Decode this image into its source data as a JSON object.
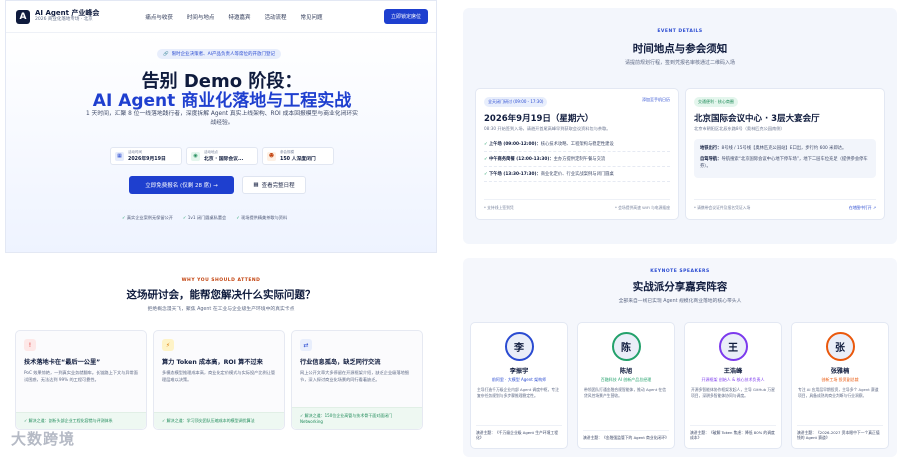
{
  "nav": {
    "logo_letter": "A",
    "brand_title": "AI Agent 产业峰会",
    "brand_sub": "2026 商业化落地专场 · 北京",
    "links": [
      "痛点与收获",
      "时间与地点",
      "特邀嘉宾",
      "活动流程",
      "常见问题"
    ],
    "cta": "立即锁定席位"
  },
  "hero": {
    "pill": "限时企业决策者、AI产品负责人等席位的开放门登记",
    "title_line1": "告别 Demo 阶段：",
    "title_line2": "AI Agent 商业化落地与工程实战",
    "subtitle": "1 天时间，汇聚 8 位一线落地践行者，深度拆解 Agent 真实上线架构、ROI 成本回报模型与商业化闭环实战经验。",
    "info": [
      {
        "icon": "calendar-icon",
        "label": "活动时间",
        "value": "2026年9月19日"
      },
      {
        "icon": "location-icon",
        "label": "活动地点",
        "value": "北京 · 国际会议..."
      },
      {
        "icon": "people-icon",
        "label": "参会规模",
        "value": "150 人深度闭门"
      }
    ],
    "cta_primary": "立即免费报名 (仅剩 28 席) →",
    "cta_secondary": "查看完整日程",
    "badges": [
      "真实企业案例无保留公开",
      "1v1 闭门圆桌私董会",
      "现场提供精美茶歇与资料"
    ]
  },
  "event": {
    "kicker": "EVENT DETAILS",
    "title": "时间地点与参会须知",
    "subtitle": "请提前规划行程，签到凭报名审核通过二维码入场",
    "time_card": {
      "tag": "全天闭门研讨 (09:00 - 17:30)",
      "link": "添加至手机日历",
      "date": "2026年9月19日（星期六）",
      "note": "08:30 开始签到入场，请避开首尾高峰早到获取会议资料包与茶歇。",
      "rows": [
        {
          "time": "上午场 (09:00-12:00)：",
          "text": "核心技术攻略、工程架构与稳定性建设"
        },
        {
          "time": "中午商务简餐 (12:00-13:30)：",
          "text": "主办方提供定制午餐与交流"
        },
        {
          "time": "下午场 (13:30-17:30)：",
          "text": "商业化定价、行业实战案例与闭门圆桌"
        }
      ],
      "foot_left": "* 支持线上签到凭",
      "foot_right": "* 会场提供高速 WiFi 与电源插座"
    },
    "loc_card": {
      "tag": "交通便利 · 核心商圈",
      "venue": "北京国际会议中心 · 3层大宴会厅",
      "address": "北京市朝阳区北辰东路8号（奥林匹克公园南侧）",
      "rows": [
        {
          "label": "地铁出行：",
          "text": "8号线 / 15号线【奥林匹克公园站】E口出，步行约 600 米即达。"
        },
        {
          "label": "自驾导航：",
          "text": "导航搜索“北京国际会议中心地下停车场”，地下二层车位充足（提供参会停车券）。"
        }
      ],
      "foot_left": "* 请携带会议证件及报名凭证入场",
      "foot_right": "在地图中打开 ↗"
    }
  },
  "why": {
    "kicker": "WHY YOU SHOULD ATTEND",
    "title": "这场研讨会，能帮您解决什么实际问题？",
    "subtitle": "拒绝概念漫天飞，聚焦 Agent 在工业与企业级生产环境中的真实卡点",
    "cards": [
      {
        "icon": "alert-icon",
        "glyph": "!",
        "title": "技术落地卡在“最后一公里”",
        "desc": "PoC 效果惊艳，一到真实业务就翻车。长链路上下文与异常面试困惑，无法达到 99% 的工程可靠性。",
        "solution": "✓ 解决之道：剖析头部企业工程化容错与评测体系"
      },
      {
        "icon": "lightning-icon",
        "glyph": "⚡",
        "title": "算力 Token 成本高，ROI 算不过来",
        "desc": "多模态模型推理成本高，商业化定价模式与实际投产比例让管理层难以决策。",
        "solution": "✓ 解决之道：学习顶尖团队压缩成本的模型调优算法"
      },
      {
        "icon": "shuffle-icon",
        "glyph": "⇄",
        "title": "行业信息孤岛，缺乏同行交流",
        "desc": "网上公开文章大多停留在开源框架介绍，缺乏企业级落地细节，深入探讨商业化场景的同行看着缺乏。",
        "solution": "✓ 解决之道：150位企业高管与技术骨干面对面闭门 Networking"
      }
    ],
    "watermark": "大数跨境"
  },
  "speakers": {
    "kicker": "KEYNOTE SPEAKERS",
    "title": "实战派分享嘉宾阵容",
    "subtitle": "全部来自一线已实现 Agent 规模化商业落地的核心带头人",
    "list": [
      {
        "initial": "李",
        "name": "李振宇",
        "role": "前阿里 · 大模型 Agent 架构师",
        "desc": "主导打造千万级企业内部 Agent 调度中枢，专注复杂任务规划与多步骤推理稳定性。",
        "topic": "演讲主题：《千万级企业级 Agent 生产环境工程化》",
        "color": "#2a4bd1"
      },
      {
        "initial": "陈",
        "name": "陈旭",
        "role": "百融科技 AI 创新产品总经理",
        "desc": "带领团队打通金融合规智能体，推动 Agent 在信贷风控场景产生营收。",
        "topic": "演讲主题：《金融强监管下的 Agent 商业化闭环》",
        "color": "#23a16b"
      },
      {
        "initial": "王",
        "name": "王浩峰",
        "role": "开源框架 创始人 & 核心技术负责人",
        "desc": "开源多智能体协作框架发起人，主导 GitHub 万星项目，深耕多智能体协同与调度。",
        "topic": "演讲主题：《破解 Token 焦虑：降低 80% 的调度成本》",
        "color": "#7c3aed"
      },
      {
        "initial": "张",
        "name": "张雅楠",
        "role": "创新工场 投资副总裁",
        "desc": "专注 AI 应用层早期投资，主导多个 Agent 赛道项目，具备成熟的商业判断与行业洞察。",
        "topic": "演讲主题：《2026-2027 资本眼中下一个真正值钱的 Agent 赛道》",
        "color": "#ea580c"
      }
    ]
  }
}
